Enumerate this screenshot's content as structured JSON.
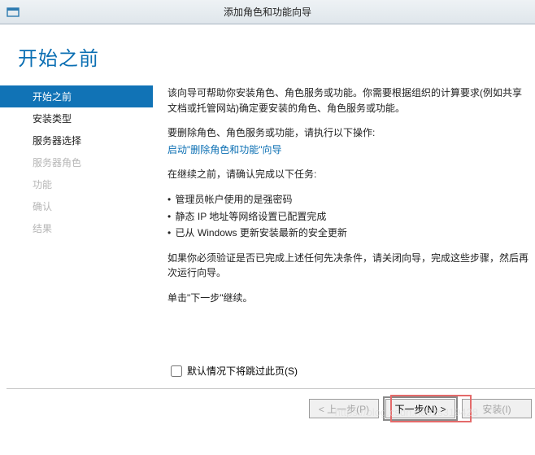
{
  "window": {
    "title": "添加角色和功能向导"
  },
  "header": {
    "title": "开始之前"
  },
  "sidebar": {
    "items": [
      {
        "label": "开始之前",
        "state": "selected"
      },
      {
        "label": "安装类型",
        "state": "enabled"
      },
      {
        "label": "服务器选择",
        "state": "enabled"
      },
      {
        "label": "服务器角色",
        "state": "disabled"
      },
      {
        "label": "功能",
        "state": "disabled"
      },
      {
        "label": "确认",
        "state": "disabled"
      },
      {
        "label": "结果",
        "state": "disabled"
      }
    ]
  },
  "content": {
    "intro": "该向导可帮助你安装角色、角色服务或功能。你需要根据组织的计算要求(例如共享文档或托管网站)确定要安装的角色、角色服务或功能。",
    "remove_line": "要删除角色、角色服务或功能，请执行以下操作:",
    "remove_link": "启动\"删除角色和功能\"向导",
    "before_line": "在继续之前，请确认完成以下任务:",
    "bullets": [
      "管理员帐户使用的是强密码",
      "静态 IP 地址等网络设置已配置完成",
      "已从 Windows 更新安装最新的安全更新"
    ],
    "verify_line": "如果你必须验证是否已完成上述任何先决条件，请关闭向导，完成这些步骤，然后再次运行向导。",
    "continue_line": "单击\"下一步\"继续。"
  },
  "skip": {
    "label": "默认情况下将跳过此页(S)"
  },
  "buttons": {
    "prev": "< 上一步(P)",
    "next": "下一步(N) >",
    "install": "安装(I)"
  },
  "watermark": "https://blog.csdn.net/zs319428"
}
